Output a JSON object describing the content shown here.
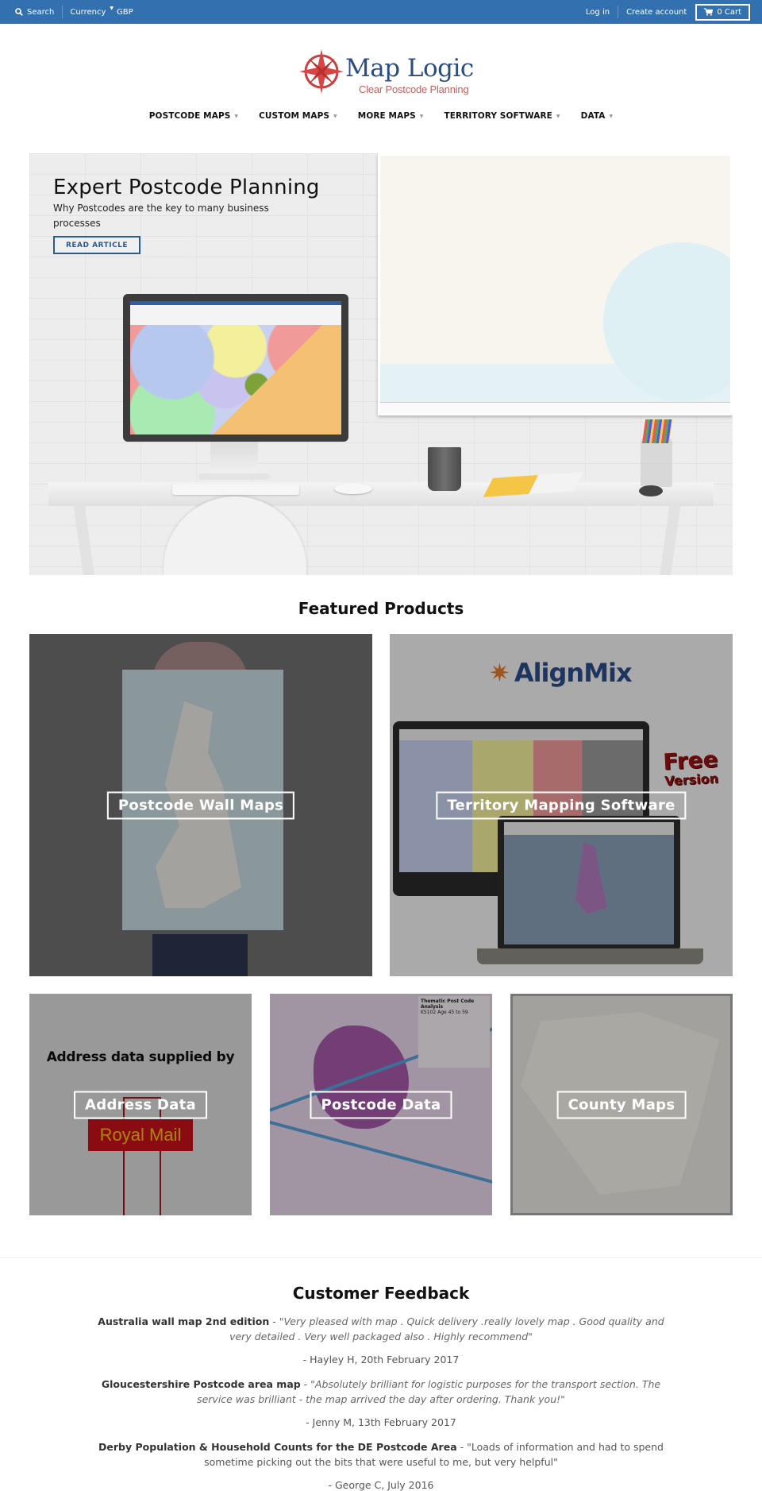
{
  "topbar": {
    "search_label": "Search",
    "currency_label": "Currency",
    "currency_value": "GBP",
    "login_label": "Log in",
    "create_account_label": "Create account",
    "cart_label": "0 Cart",
    "background_color": "#3370b0"
  },
  "logo": {
    "name": "Map Logic",
    "tagline": "Clear Postcode Planning"
  },
  "nav": {
    "items": [
      {
        "label": "POSTCODE MAPS"
      },
      {
        "label": "CUSTOM MAPS"
      },
      {
        "label": "MORE MAPS"
      },
      {
        "label": "TERRITORY SOFTWARE"
      },
      {
        "label": "DATA"
      }
    ]
  },
  "hero": {
    "title": "Expert Postcode Planning",
    "subtitle": "Why Postcodes are the key to many business processes",
    "button_label": "READ ARTICLE"
  },
  "featured": {
    "title": "Featured Products",
    "tiles": [
      {
        "label": "Postcode Wall Maps"
      },
      {
        "label": "Territory Mapping Software",
        "brand": "AlignMix",
        "badge_top": "Free",
        "badge_bottom": "Version"
      },
      {
        "label": "Address Data",
        "image_text": "Address data supplied by",
        "brand": "Royal Mail"
      },
      {
        "label": "Postcode Data",
        "legend_title": "Thematic Post Code Analysis",
        "legend_subtitle": "KS102 Age 45 to 59"
      },
      {
        "label": "County Maps"
      }
    ]
  },
  "feedback": {
    "title": "Customer Feedback",
    "reviews": [
      {
        "product": "Australia wall map 2nd edition",
        "sep": " - ",
        "quote": "\"Very pleased with map . Quick delivery .really lovely map . Good quality and very detailed . Very well packaged also . Highly recommend\"",
        "author": "- Hayley H, 20th February 2017"
      },
      {
        "product": "Gloucestershire Postcode area map",
        "sep": " - ",
        "quote": "\"Absolutely brilliant for logistic purposes for the transport section. The service was brilliant - the map arrived the day after ordering. Thank you!\"",
        "author": "- Jenny M, 13th February 2017"
      },
      {
        "product": "Derby Population & Household Counts for the DE Postcode Area",
        "sep": " - ",
        "quote": "\"Loads of information and had to spend sometime picking out the bits that were useful to me, but very helpful\"",
        "author": "- George C, July 2016"
      }
    ]
  }
}
